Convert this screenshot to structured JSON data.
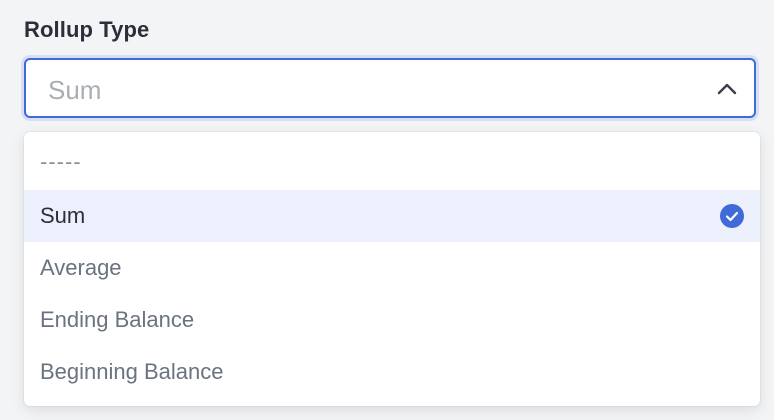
{
  "field": {
    "label": "Rollup Type",
    "selected_value": "Sum"
  },
  "colors": {
    "accent": "#3f6ad8",
    "selected_row": "#ecf0fc"
  },
  "dropdown": {
    "options": [
      {
        "label": "-----",
        "selected": false
      },
      {
        "label": "Sum",
        "selected": true
      },
      {
        "label": "Average",
        "selected": false
      },
      {
        "label": "Ending Balance",
        "selected": false
      },
      {
        "label": "Beginning Balance",
        "selected": false
      }
    ],
    "selected_icon": "check-circle-icon",
    "toggle_icon": "chevron-up-icon"
  }
}
